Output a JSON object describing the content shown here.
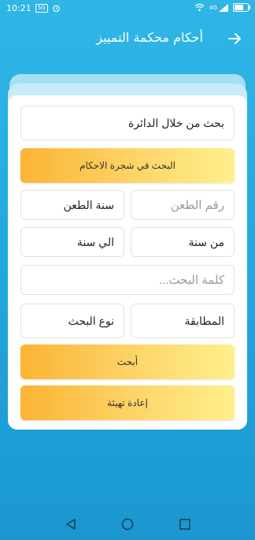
{
  "status_bar": {
    "time": "10:21",
    "sim_badge": "5G",
    "network": "4G",
    "battery_level_percent": 70
  },
  "header": {
    "title": "أحكام محكمة التمييز"
  },
  "form": {
    "search_by_circuit": "بحث من خلال الدائرة",
    "tree_search_button": "البحث في شجرة الاحكام",
    "appeal_number_placeholder": "رقم الطعن",
    "appeal_year": "سنة الطعن",
    "from_year": "من سنة",
    "to_year": "الي سنة",
    "keyword_placeholder": "كلمة البحث...",
    "match_type": "المطابقة",
    "search_type": "نوع البحث",
    "search_button": "أبحث",
    "reset_button": "إعادة تهيئة"
  },
  "colors": {
    "accent_gold": "#fbb433",
    "background_blue": "#22a6dc"
  },
  "icons": [
    "back-arrow-icon",
    "nav-back-icon",
    "nav-home-icon",
    "nav-recents-icon",
    "wifi-icon",
    "signal-icon",
    "battery-icon",
    "alarm-icon"
  ]
}
